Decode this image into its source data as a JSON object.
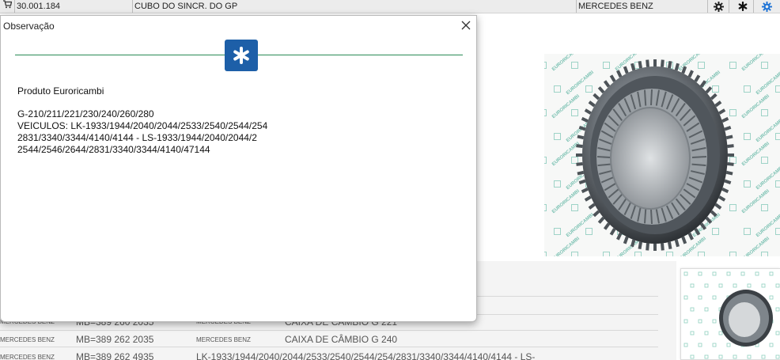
{
  "topbar": {
    "code": "30.001.184",
    "description": "CUBO DO SINCR. DO GP",
    "brand": "MERCEDES BENZ",
    "icons": [
      "cart-icon",
      "gear-icon",
      "asterisk-icon",
      "settings-cog-icon"
    ]
  },
  "dialog": {
    "title": "Observação",
    "close_label": "✕",
    "badge_icon": "asterisk-icon",
    "lines": [
      "Produto Euroricambi",
      "G-210/211/221/230/240/260/280",
      "VEICULOS: LK-1933/1944/2040/2044/2533/2540/2544/254",
      "2831/3340/3344/4140/4144 - LS-1933/1944/2040/2044/2",
      "2544/2546/2644/2831/3340/3344/4140/47144"
    ]
  },
  "references": {
    "rows": [
      {
        "brand": "MERCEDES BENZ",
        "code": "MB=389 260 2035",
        "brand2": "MERCEDES BENZ",
        "application": "CAIXA DE CÂMBIO G 221"
      },
      {
        "brand": "MERCEDES BENZ",
        "code": "MB=389 262 2035",
        "brand2": "MERCEDES BENZ",
        "application": "CAIXA DE CÂMBIO G 240"
      },
      {
        "brand": "MERCEDES BENZ",
        "code": "MB=389 262 4935",
        "brand2": "",
        "application": "LK-1933/1944/2040/2044/2533/2540/2544/254/2831/3340/3344/4140/4144 - LS-"
      }
    ]
  },
  "photo": {
    "watermark_text": "EURORICAMBI",
    "alt_label": "product-photo"
  },
  "colors": {
    "accent_green": "#2a8a55",
    "badge_blue": "#1d5fa8",
    "settings_blue": "#1f74d6"
  }
}
